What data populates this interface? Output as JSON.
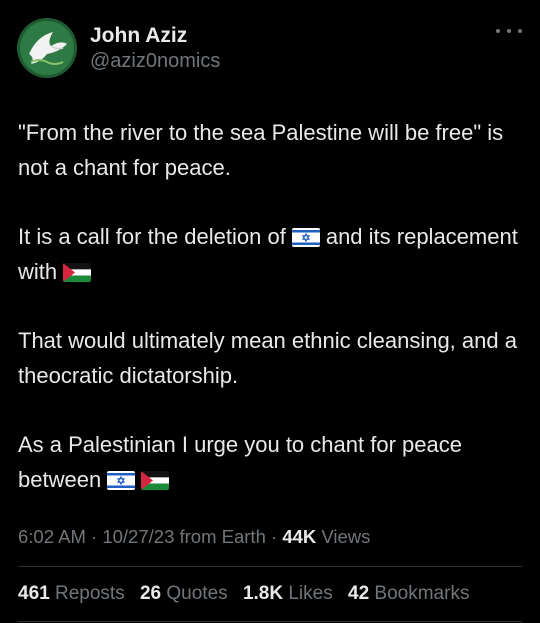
{
  "author": {
    "name": "John Aziz",
    "handle": "@aziz0nomics"
  },
  "tweet": {
    "line1": "\"From the river to the sea Palestine will be free\" is not a chant for peace.",
    "line2_before": "It is a call for the deletion of",
    "line2_after": "and its replacement with",
    "line3": "That would ultimately mean ethnic cleansing, and a theocratic dictatorship.",
    "line4": "As a Palestinian I urge you to chant for peace between"
  },
  "meta": {
    "time": "6:02 AM",
    "sep1": " · ",
    "date": "10/27/23 from Earth",
    "sep2": " · ",
    "views_count": "44K",
    "views_label": "Views"
  },
  "stats": {
    "reposts_count": "461",
    "reposts_label": "Reposts",
    "quotes_count": "26",
    "quotes_label": "Quotes",
    "likes_count": "1.8K",
    "likes_label": "Likes",
    "bookmarks_count": "42",
    "bookmarks_label": "Bookmarks"
  },
  "icons": {
    "avatar": "dove-avatar",
    "more": "more-icon",
    "flag_israel": "israel-flag-icon",
    "flag_palestine": "palestine-flag-icon"
  },
  "colors": {
    "background": "#000000",
    "text": "#e7e9ea",
    "secondary_text": "#71767b",
    "divider": "#2f3336"
  }
}
